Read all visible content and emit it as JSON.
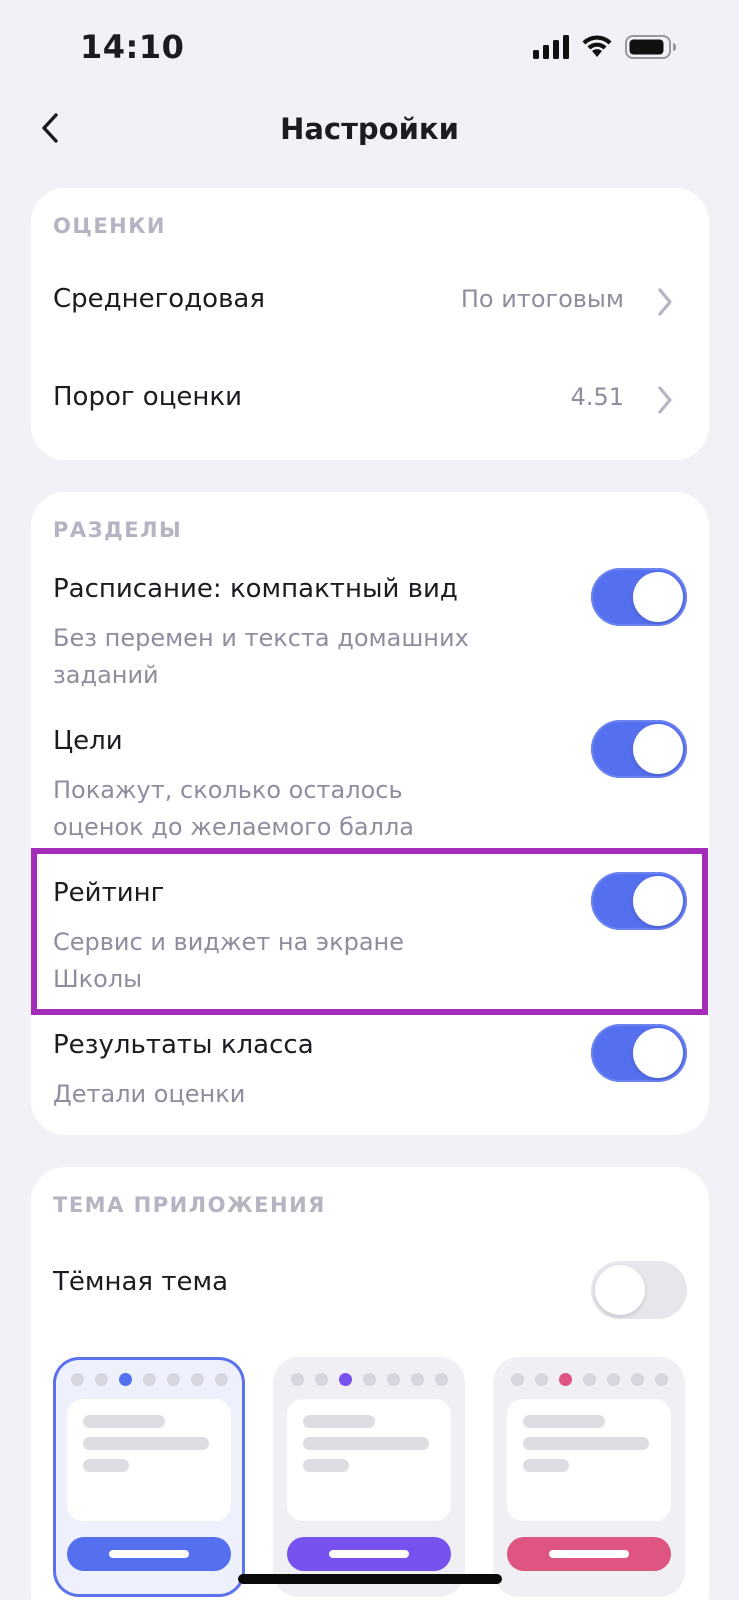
{
  "status": {
    "time": "14:10",
    "icons": [
      "signal-icon",
      "wifi-icon",
      "battery-icon"
    ]
  },
  "header": {
    "title": "Настройки",
    "back_icon": "chevron-left-icon"
  },
  "grades": {
    "section_title": "ОЦЕНКИ",
    "rows": [
      {
        "label": "Среднегодовая",
        "value": "По итоговым"
      },
      {
        "label": "Порог оценки",
        "value": "4.51"
      }
    ]
  },
  "sections": {
    "section_title": "РАЗДЕЛЫ",
    "items": [
      {
        "label": "Расписание: компактный вид",
        "desc": "Без перемен и текста домашних заданий",
        "enabled": true
      },
      {
        "label": "Цели",
        "desc": "Покажут, сколько осталось оценок до желаемого балла",
        "enabled": true
      },
      {
        "label": "Рейтинг",
        "desc": "Сервис и виджет на экране Школы",
        "enabled": true,
        "highlighted": true
      },
      {
        "label": "Результаты класса",
        "desc": "Детали оценки",
        "enabled": true
      }
    ]
  },
  "theme": {
    "section_title": "ТЕМА ПРИЛОЖЕНИЯ",
    "dark_mode": {
      "label": "Тёмная тема",
      "enabled": false
    },
    "options": [
      {
        "accent": "#5570EE",
        "selected": true
      },
      {
        "accent": "#7752EE",
        "selected": false
      },
      {
        "accent": "#DD5580",
        "selected": false
      }
    ]
  },
  "colors": {
    "accent": "#5570EE",
    "highlight": "#A32DB8",
    "background": "#F2F1F7"
  }
}
